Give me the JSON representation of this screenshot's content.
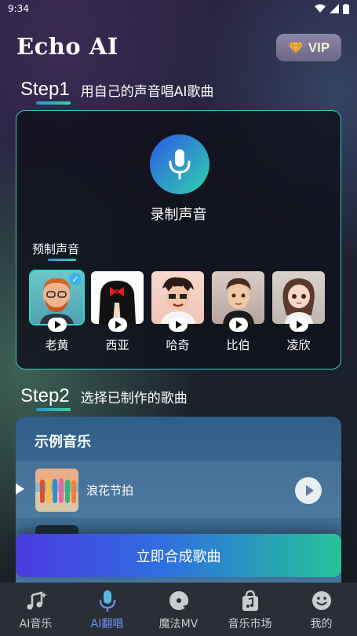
{
  "status": {
    "time": "9:34"
  },
  "header": {
    "app_title": "Echo AI",
    "vip_label": "VIP"
  },
  "step1": {
    "label": "Step1",
    "text": "用自己的声音唱AI歌曲"
  },
  "record": {
    "label": "录制声音"
  },
  "preset": {
    "title": "预制声音",
    "voices": [
      {
        "name": "老黄",
        "selected": true
      },
      {
        "name": "西亚",
        "selected": false
      },
      {
        "name": "哈奇",
        "selected": false
      },
      {
        "name": "比伯",
        "selected": false
      },
      {
        "name": "凌欣",
        "selected": false
      }
    ]
  },
  "step2": {
    "label": "Step2",
    "text": "选择已制作的歌曲"
  },
  "songs": {
    "title": "示例音乐",
    "items": [
      {
        "name": "浪花节拍"
      }
    ]
  },
  "synth_button": "立即合成歌曲",
  "tabs": [
    {
      "label": "AI音乐",
      "icon": "music-note-sparkle-icon",
      "active": false
    },
    {
      "label": "AI翻唱",
      "icon": "microphone-icon",
      "active": true
    },
    {
      "label": "魔法MV",
      "icon": "vinyl-icon",
      "active": false
    },
    {
      "label": "音乐市场",
      "icon": "shopping-bag-music-icon",
      "active": false
    },
    {
      "label": "我的",
      "icon": "smiley-icon",
      "active": false
    }
  ],
  "colors": {
    "accent": "#3fc5c0",
    "active_tab": "#6f8ff7"
  }
}
